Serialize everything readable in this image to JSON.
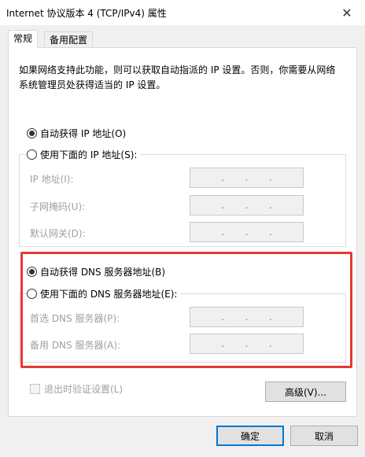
{
  "window": {
    "title": "Internet 协议版本 4 (TCP/IPv4) 属性",
    "close_glyph": "✕"
  },
  "tabs": [
    {
      "label": "常规"
    },
    {
      "label": "备用配置"
    }
  ],
  "description": "如果网络支持此功能，则可以获取自动指派的 IP 设置。否则，你需要从网络系统管理员处获得适当的 IP 设置。",
  "ip_section": {
    "auto_label": "自动获得 IP 地址(O)",
    "manual_label": "使用下面的 IP 地址(S):",
    "selected": "auto",
    "fields": [
      {
        "label": "IP 地址(I):",
        "value": ".   .   ."
      },
      {
        "label": "子网掩码(U):",
        "value": ".   .   ."
      },
      {
        "label": "默认网关(D):",
        "value": ".   .   ."
      }
    ]
  },
  "dns_section": {
    "auto_label": "自动获得 DNS 服务器地址(B)",
    "manual_label": "使用下面的 DNS 服务器地址(E):",
    "selected": "auto",
    "highlight_color": "#e53935",
    "fields": [
      {
        "label": "首选 DNS 服务器(P):",
        "value": ".   .   ."
      },
      {
        "label": "备用 DNS 服务器(A):",
        "value": ".   .   ."
      }
    ]
  },
  "validate_checkbox": {
    "label": "退出时验证设置(L)",
    "checked": false,
    "enabled": false
  },
  "buttons": {
    "advanced": "高级(V)...",
    "ok": "确定",
    "cancel": "取消"
  }
}
